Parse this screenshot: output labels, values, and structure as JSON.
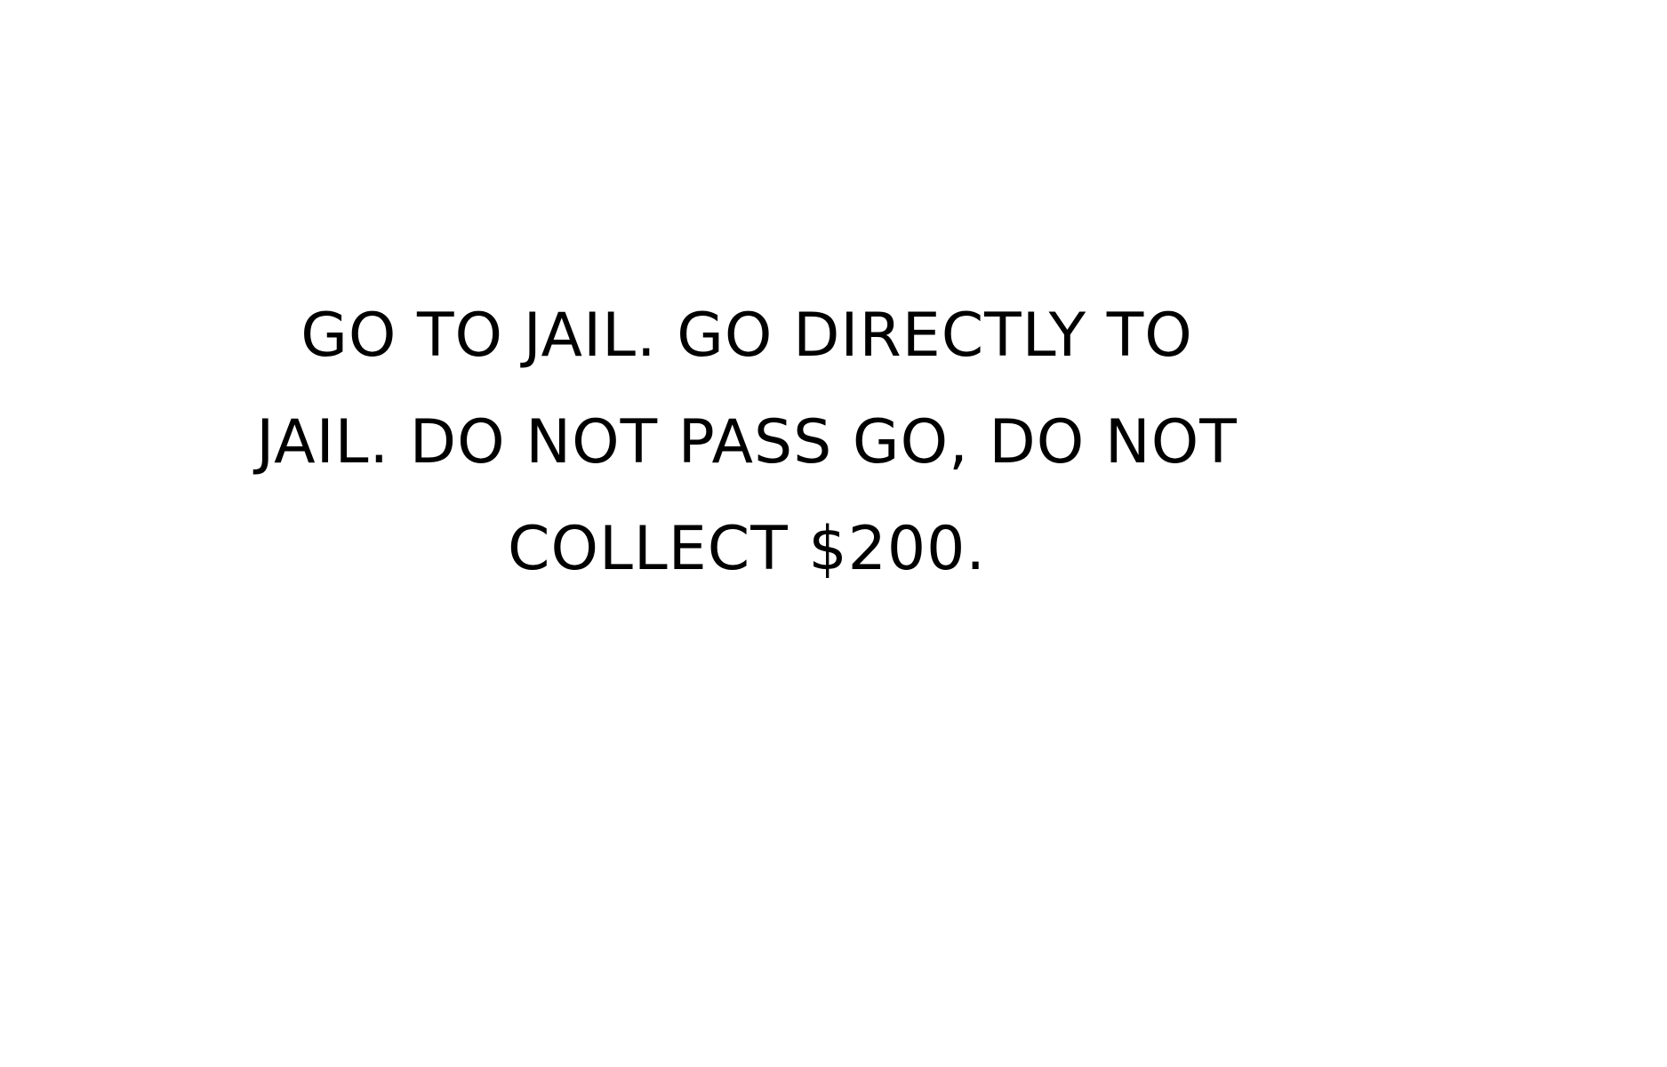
{
  "card": {
    "lines": [
      "GO TO JAIL. GO DIRECTLY TO",
      "JAIL. DO NOT PASS GO, DO NOT",
      "COLLECT $200."
    ]
  },
  "colors": {
    "background": "#ffffff",
    "text": "#000000"
  }
}
